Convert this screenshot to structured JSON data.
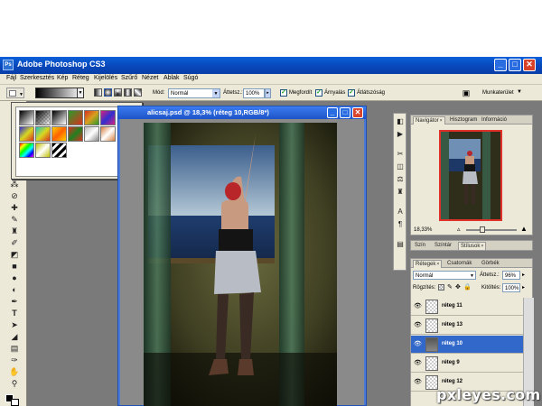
{
  "app": {
    "title": "Adobe Photoshop CS3",
    "logo": "Ps"
  },
  "window_buttons": {
    "min": "_",
    "max": "□",
    "close": "✕"
  },
  "menu": [
    "Fájl",
    "Szerkesztés",
    "Kép",
    "Réteg",
    "Kijelölés",
    "Szűrő",
    "Nézet",
    "Ablak",
    "Súgó"
  ],
  "options": {
    "mode_label": "Mód:",
    "mode_value": "Normál",
    "opacity_label": "Áttetsz.:",
    "opacity_value": "100%",
    "reverse_label": "Megfordít",
    "dither_label": "Árnyalás",
    "transparency_label": "Átlátszóság",
    "workspace_label": "Munkaterület"
  },
  "document": {
    "title": "alicsaj.psd @ 18,3% (réteg 10,RGB/8*)"
  },
  "navigator": {
    "tabs": [
      "Navigátor",
      "Hisztogram",
      "Információ"
    ],
    "zoom": "18,33%"
  },
  "color_panel": {
    "tabs": [
      "Szín",
      "Színtár",
      "Stílusok"
    ]
  },
  "layers_panel": {
    "tabs": [
      "Rétegek",
      "Csatornák",
      "Görbék"
    ],
    "blend_mode": "Normál",
    "opacity_label": "Áttetsz.:",
    "opacity_value": "96%",
    "lock_label": "Rögzítés:",
    "fill_label": "Kitöltés:",
    "fill_value": "100%",
    "layers": [
      {
        "name": "réteg 11",
        "selected": false
      },
      {
        "name": "réteg 13",
        "selected": false
      },
      {
        "name": "réteg 10",
        "selected": true
      },
      {
        "name": "réteg 9",
        "selected": false
      },
      {
        "name": "réteg 12",
        "selected": false
      }
    ]
  },
  "watermark": "pxleyes.com",
  "colors": {
    "titlebar": "#0846b8",
    "chrome": "#ece9d8",
    "selected_layer": "#3268c9",
    "workspace": "#7a7a7a"
  }
}
